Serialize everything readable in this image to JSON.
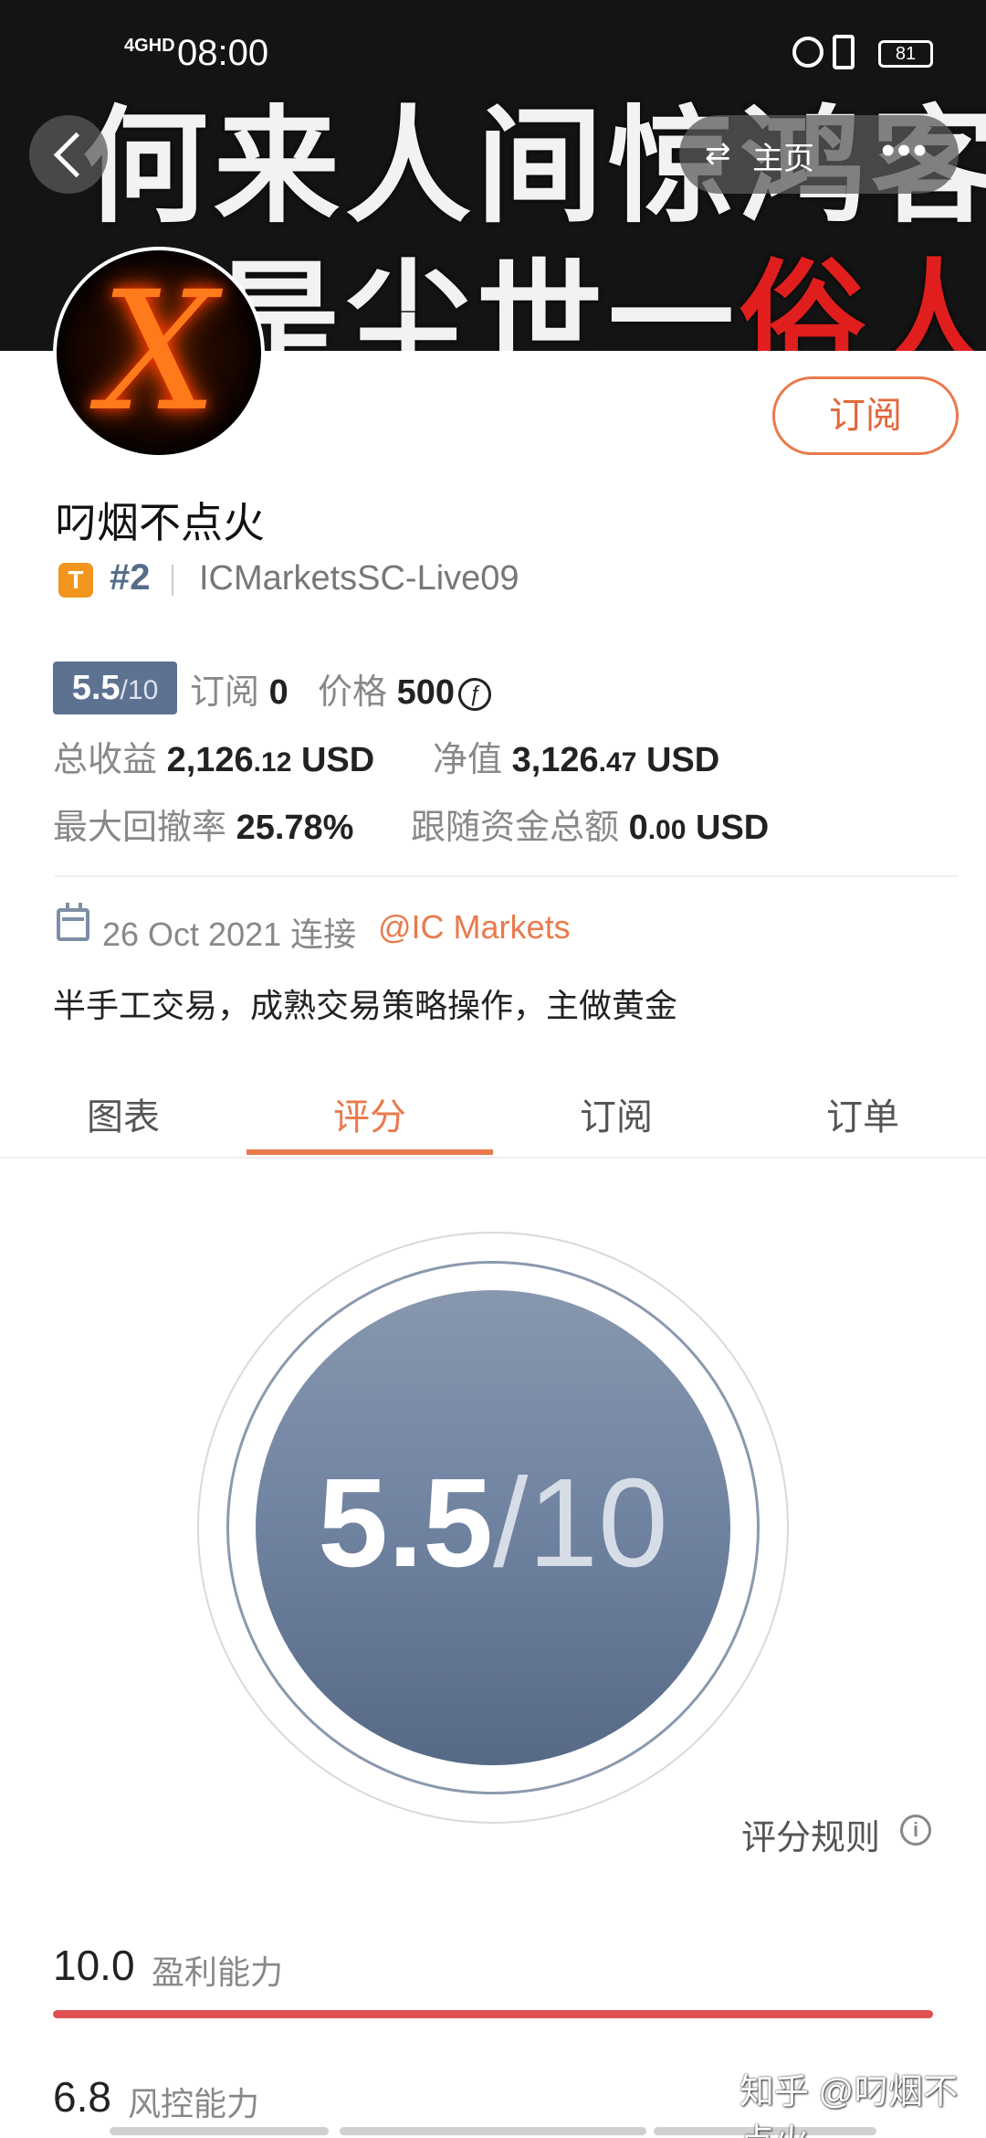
{
  "status_bar": {
    "signal": "4GHD",
    "time": "08:00",
    "battery": "81"
  },
  "banner": {
    "line1": "何来人间惊鸿客",
    "line2_prefix": "只是尘世一",
    "line2_highlight": "俗人"
  },
  "nav": {
    "home_label": "主页",
    "more": "•••"
  },
  "profile": {
    "avatar_glyph": "X",
    "subscribe_label": "订阅",
    "name": "叼烟不点火",
    "badge": "T",
    "rank": "#2",
    "account": "ICMarketsSC-Live09"
  },
  "stats": {
    "score_main": "5.5",
    "score_den": "/10",
    "subscribe_label": "订阅",
    "subscribe_value": "0",
    "price_label": "价格",
    "price_value": "500",
    "coin": "ƒ",
    "total_profit_label": "总收益",
    "total_profit_int": "2,126",
    "total_profit_dec": ".12",
    "total_profit_unit": "USD",
    "equity_label": "净值",
    "equity_int": "3,126",
    "equity_dec": ".47",
    "equity_unit": "USD",
    "drawdown_label": "最大回撤率",
    "drawdown_value": "25.78%",
    "follow_label": "跟随资金总额",
    "follow_int": "0",
    "follow_dec": ".00",
    "follow_unit": "USD"
  },
  "join": {
    "date_text": "26 Oct 2021 连接",
    "broker": "@IC Markets"
  },
  "description": "半手工交易，成熟交易策略操作，主做黄金",
  "tabs": [
    "图表",
    "评分",
    "订阅",
    "订单"
  ],
  "active_tab": 1,
  "score_ring": {
    "main": "5.5",
    "den": "/10"
  },
  "rules": {
    "label": "评分规则",
    "icon": "i"
  },
  "metrics": [
    {
      "value": "10.0",
      "label": "盈利能力",
      "fraction": 1.0
    },
    {
      "value": "6.8",
      "label": "风控能力",
      "fraction": 0.68
    }
  ],
  "watermark": "知乎 @叼烟不点火",
  "colors": {
    "accent": "#e97a4d",
    "score_bg": "#5d7291",
    "profit_bar": "#e05252"
  }
}
